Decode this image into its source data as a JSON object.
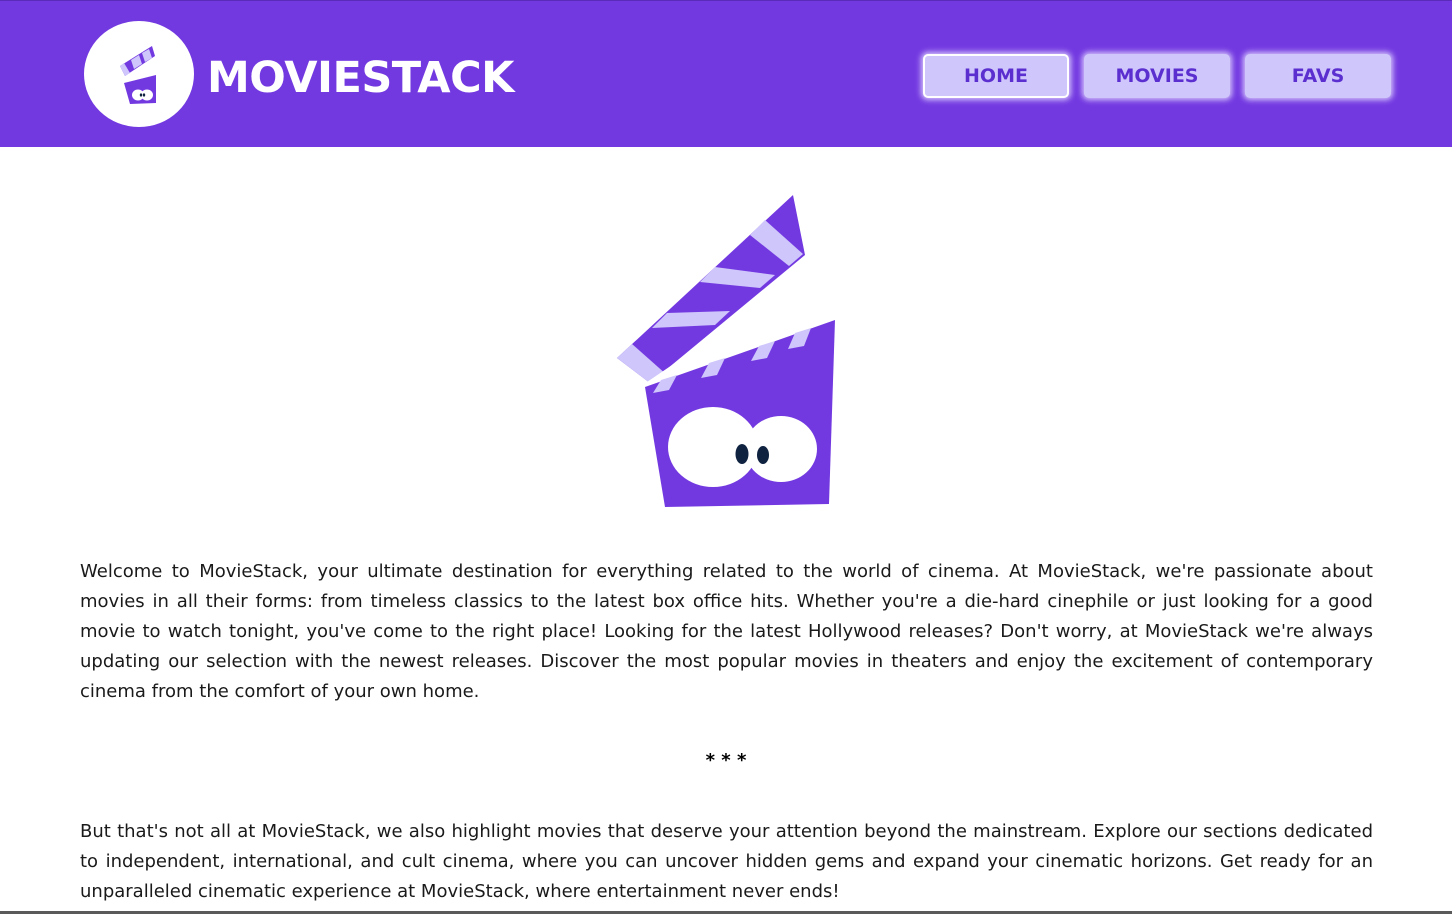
{
  "brand": {
    "name": "MOVIESTACK",
    "logo_icon": "clapperboard-icon"
  },
  "nav": [
    {
      "label": "HOME",
      "active": true
    },
    {
      "label": "MOVIES",
      "active": false
    },
    {
      "label": "FAVS",
      "active": false
    }
  ],
  "hero": {
    "icon": "clapperboard-mascot-icon"
  },
  "content": {
    "paragraph1": "Welcome to MovieStack, your ultimate destination for everything related to the world of cinema. At MovieStack, we're passionate about movies in all their forms: from timeless classics to the latest box office hits. Whether you're a die-hard cinephile or just looking for a good movie to watch tonight, you've come to the right place! Looking for the latest Hollywood releases? Don't worry, at MovieStack we're always updating our selection with the newest releases. Discover the most popular movies in theaters and enjoy the excitement of contemporary cinema from the comfort of your own home.",
    "separator": "* * *",
    "paragraph2": "But that's not all at MovieStack, we also highlight movies that deserve your attention beyond the mainstream. Explore our sections dedicated to independent, international, and cult cinema, where you can uncover hidden gems and expand your cinematic horizons. Get ready for an unparalleled cinematic experience at MovieStack, where entertainment never ends!"
  },
  "colors": {
    "header_bg": "#7339e1",
    "button_bg": "#cfc6fb",
    "button_text": "#5b2fcf",
    "accent_light": "#cfc6fb",
    "body_text": "#1a1a1a"
  }
}
